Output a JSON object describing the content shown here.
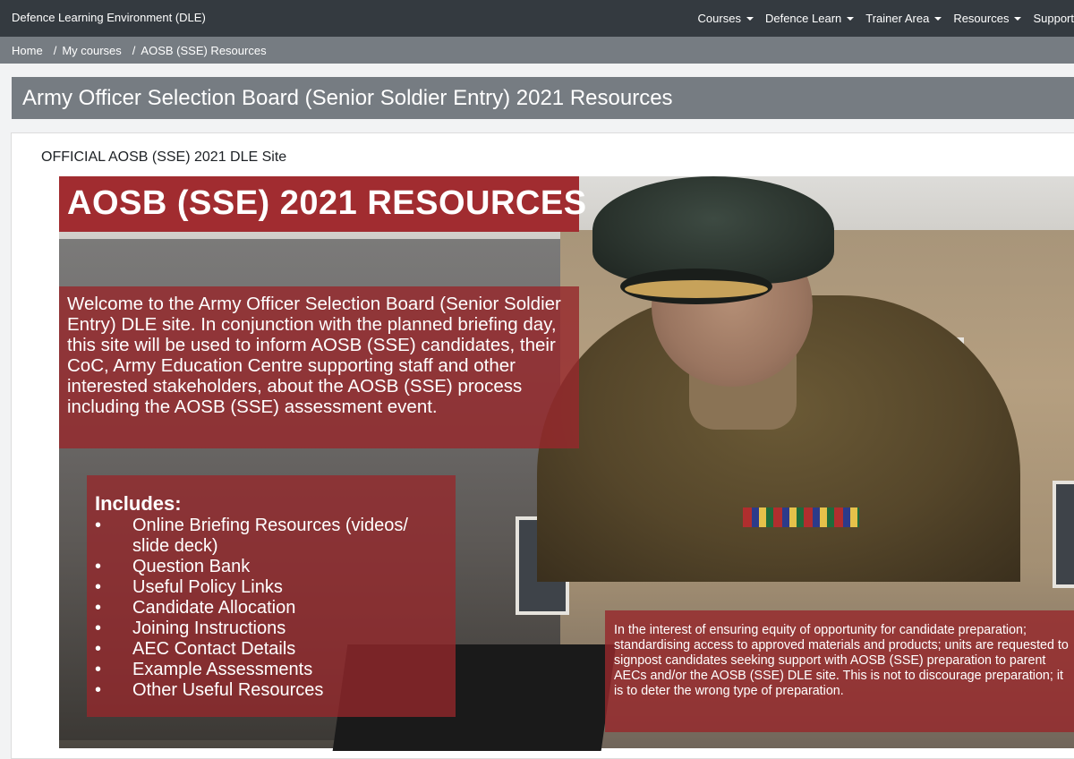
{
  "brand": "Defence Learning Environment (DLE)",
  "nav": {
    "items": [
      {
        "label": "Courses",
        "dropdown": true
      },
      {
        "label": "Defence Learn",
        "dropdown": true
      },
      {
        "label": "Trainer Area",
        "dropdown": true
      },
      {
        "label": "Resources",
        "dropdown": true
      },
      {
        "label": "Support",
        "dropdown": false
      }
    ]
  },
  "breadcrumb": {
    "home": "Home",
    "my_courses": "My courses",
    "current": "AOSB (SSE) Resources"
  },
  "page_title": "Army Officer Selection Board (Senior Soldier Entry) 2021 Resources",
  "site_label": "OFFICIAL AOSB (SSE) 2021 DLE Site",
  "banner": {
    "title": "AOSB (SSE) 2021 RESOURCES",
    "welcome": "Welcome to the Army Officer Selection Board (Senior Soldier Entry) DLE site. In conjunction with the planned briefing day, this site will be used to inform AOSB (SSE) candidates, their CoC, Army Education Centre supporting staff and other interested stakeholders, about the AOSB (SSE) process including the AOSB (SSE) assessment event.",
    "includes_heading": "Includes:",
    "includes": [
      "Online Briefing Resources (videos/ slide deck)",
      "Question Bank",
      "Useful Policy Links",
      "Candidate Allocation",
      "Joining Instructions",
      "AEC Contact Details",
      "Example Assessments",
      "Other Useful Resources"
    ],
    "notice": "In the interest of ensuring equity of opportunity for candidate preparation; standardising access to approved materials and products; units are requested to signpost candidates seeking support with AOSB (SSE) preparation to parent AECs and/or the AOSB (SSE) DLE site.  This is not to discourage preparation; it is to deter the wrong type of preparation."
  },
  "colors": {
    "navbar": "#343a40",
    "breadcrumb_bar": "#767c82",
    "banner_red": "#a12c30"
  }
}
